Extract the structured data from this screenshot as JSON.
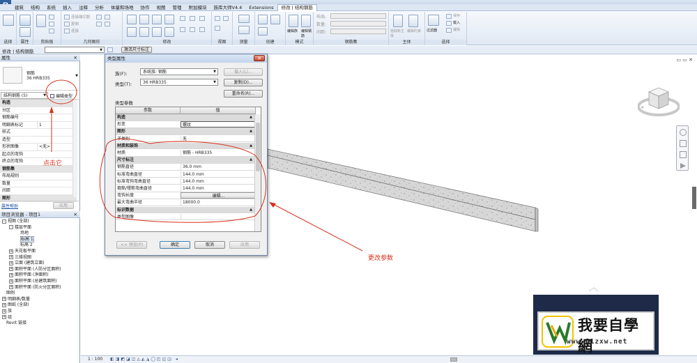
{
  "menu": [
    "建筑",
    "结构",
    "系统",
    "插入",
    "注释",
    "分析",
    "体量和场地",
    "协作",
    "视图",
    "管理",
    "附加模块",
    "族库大师V4.4",
    "Extensions",
    "修改 | 结构钢筋"
  ],
  "ribbon_groups": [
    "选择",
    "属性",
    "剪贴板",
    "几何图形",
    "修改",
    "视图",
    "测量",
    "创建",
    "模式",
    "钢筋集",
    "主体",
    "选择"
  ],
  "ribbon_small": {
    "cut": "剪切",
    "paste": "粘贴",
    "connect": "连接",
    "join": "连接端切割",
    "copy": "复制",
    "layout_label": "布局:",
    "quantity_label": "数量:",
    "spacing_label": "间距:",
    "edit_family": "编辑族",
    "edit_rebar": "编辑钢筋",
    "edit_host": "拾取新主体",
    "edit_cons": "编辑约束",
    "filter": "过滤器",
    "save": "保存",
    "load": "载入",
    "edit_sel": "编辑"
  },
  "options_bar": {
    "context": "修改 | 结构钢筋",
    "activate_dim": "激活尺寸标注"
  },
  "properties": {
    "header": "属性",
    "type_name_1": "钢筋",
    "type_name_2": "36 HRB335",
    "selector": "结构钢筋 (5)",
    "edit_type": "编辑类型",
    "rows": [
      {
        "k": "构造",
        "v": "",
        "grp": true
      },
      {
        "k": "分区",
        "v": ""
      },
      {
        "k": "钢筋编号",
        "v": ""
      },
      {
        "k": "明细表标记",
        "v": "1"
      },
      {
        "k": "样式",
        "v": ""
      },
      {
        "k": "造型",
        "v": ""
      },
      {
        "k": "形状图像",
        "v": "<无>"
      },
      {
        "k": "起点的弯钩",
        "v": ""
      },
      {
        "k": "终点的弯钩",
        "v": ""
      },
      {
        "k": "钢筋集",
        "v": "",
        "grp": true
      },
      {
        "k": "布局规则",
        "v": ""
      },
      {
        "k": "数量",
        "v": ""
      },
      {
        "k": "间距",
        "v": ""
      },
      {
        "k": "图形",
        "v": "",
        "grp": true
      }
    ],
    "help": "属性帮助",
    "apply": "应用"
  },
  "browser": {
    "header": "项目浏览器 - 项目1",
    "items": [
      {
        "label": "视图 (全部)",
        "tog": "-",
        "lvl": 0
      },
      {
        "label": "楼层平面",
        "tog": "-",
        "lvl": 1
      },
      {
        "label": "场地",
        "tog": "",
        "lvl": 2
      },
      {
        "label": "标高 1",
        "tog": "",
        "lvl": 2,
        "sel": true
      },
      {
        "label": "标高 2",
        "tog": "",
        "lvl": 2
      },
      {
        "label": "天花板平面",
        "tog": "+",
        "lvl": 1
      },
      {
        "label": "三维视图",
        "tog": "+",
        "lvl": 1
      },
      {
        "label": "立面 (建筑立面)",
        "tog": "+",
        "lvl": 1
      },
      {
        "label": "面积平面 (人防分区面积)",
        "tog": "+",
        "lvl": 1
      },
      {
        "label": "面积平面 (净面积)",
        "tog": "+",
        "lvl": 1
      },
      {
        "label": "面积平面 (总建筑面积)",
        "tog": "+",
        "lvl": 1
      },
      {
        "label": "面积平面 (防火分区面积)",
        "tog": "+",
        "lvl": 1
      },
      {
        "label": "图例",
        "tog": "",
        "lvl": 0
      },
      {
        "label": "明细表/数量",
        "tog": "+",
        "lvl": 0
      },
      {
        "label": "图纸 (全部)",
        "tog": "+",
        "lvl": 0
      },
      {
        "label": "族",
        "tog": "+",
        "lvl": 0
      },
      {
        "label": "组",
        "tog": "+",
        "lvl": 0
      },
      {
        "label": "Revit 链接",
        "tog": "",
        "lvl": 0
      }
    ]
  },
  "dialog": {
    "title": "类型属性",
    "family_label": "族(F):",
    "family_value": "系统族: 钢筋",
    "type_label": "类型(T):",
    "type_value": "36 HRB335",
    "load_btn": "载入(L)...",
    "dup_btn": "复制(D)...",
    "rename_btn": "重命名(R)...",
    "params_label": "类型参数",
    "col_param": "参数",
    "col_value": "值",
    "rows": [
      {
        "k": "构造",
        "v": "",
        "grp": true
      },
      {
        "k": "形变",
        "v": "螺纹"
      },
      {
        "k": "图形",
        "v": "",
        "grp": true
      },
      {
        "k": "子类别",
        "v": "无"
      },
      {
        "k": "材质和装饰",
        "v": "",
        "grp": true
      },
      {
        "k": "材质",
        "v": "钢筋 - HRB335"
      },
      {
        "k": "尺寸标注",
        "v": "",
        "grp": true
      },
      {
        "k": "钢筋直径",
        "v": "36.0 mm"
      },
      {
        "k": "标准弯曲直径",
        "v": "144.0 mm"
      },
      {
        "k": "标准弯钩弯曲直径",
        "v": "144.0 mm"
      },
      {
        "k": "箍筋/镫筋弯曲直径",
        "v": "144.0 mm"
      },
      {
        "k": "弯钩长度",
        "v": "编辑...",
        "btn": true
      },
      {
        "k": "最大弯曲半径",
        "v": "18000.0"
      },
      {
        "k": "标识数据",
        "v": "",
        "grp": true
      },
      {
        "k": "类型图像",
        "v": ""
      }
    ],
    "preview_btn": "<< 预览(P)",
    "ok_btn": "确定",
    "cancel_btn": "取消",
    "apply_btn": "应用"
  },
  "annotations": {
    "click_it": "点击它",
    "change_params": "更改参数"
  },
  "status": {
    "scale": "1 : 100"
  },
  "watermark": {
    "text": "我要自學網",
    "url": "www.51zxw.net"
  }
}
